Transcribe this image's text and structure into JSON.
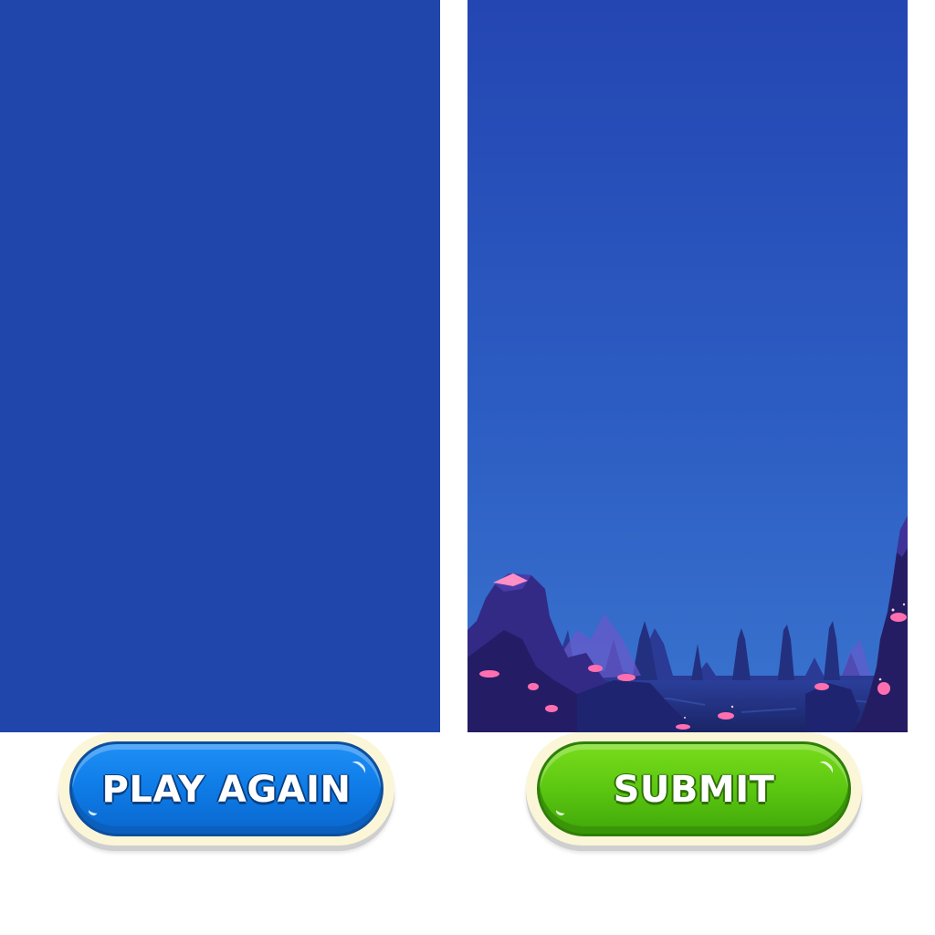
{
  "scene": {
    "left_panel_color": "#2046ab",
    "sky_top_color": "#2446b2",
    "sky_bottom_color": "#3a74cf",
    "crystal_color": "#ff6fb0"
  },
  "buttons": {
    "play_again": {
      "label": "PLAY AGAIN",
      "color": "#0f7de8"
    },
    "submit": {
      "label": "SUBMIT",
      "color": "#5cc712"
    }
  }
}
